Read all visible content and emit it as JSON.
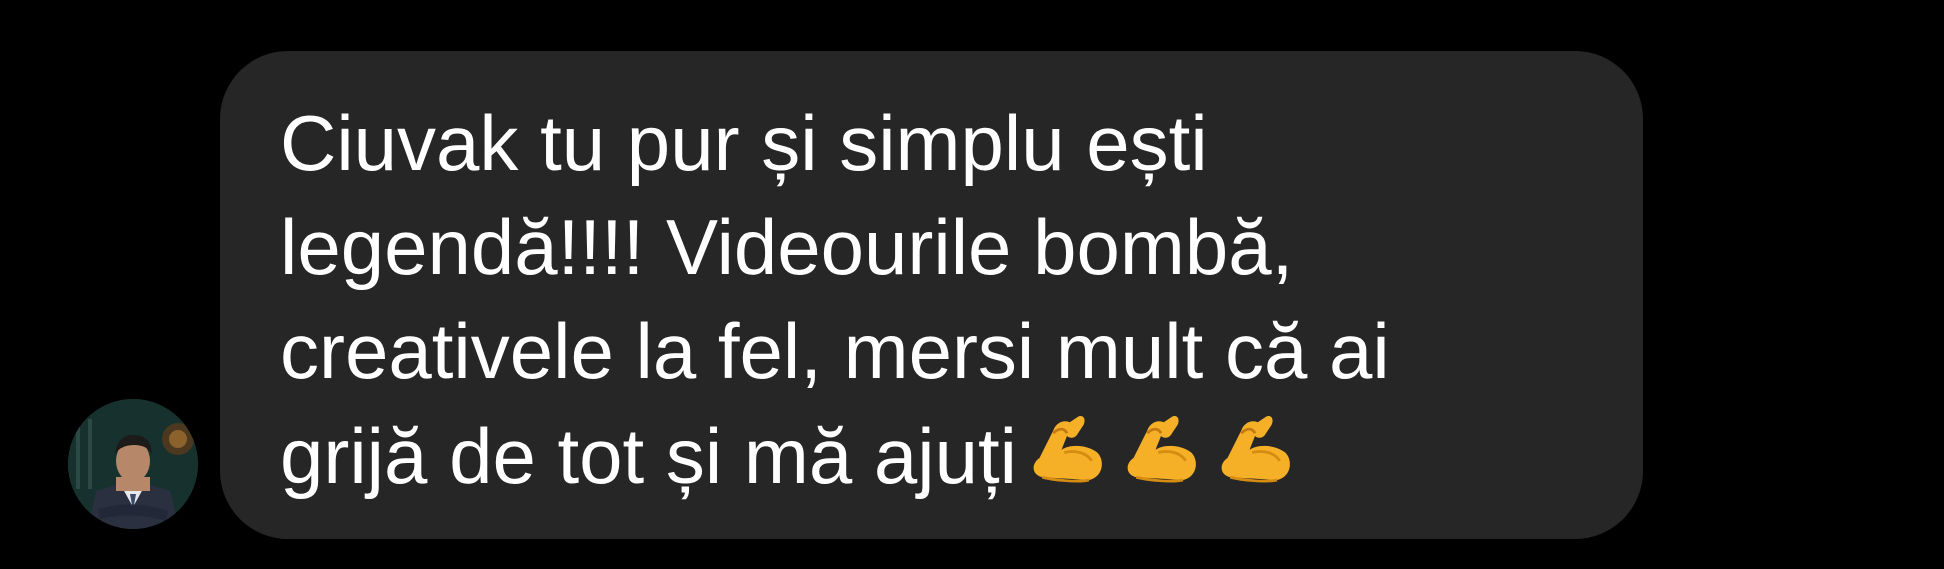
{
  "message": {
    "sender_avatar": "avatar-photo",
    "lines": [
      "Ciuvak tu pur și simplu ești",
      "legendă!!!! Videourile bombă,",
      "creativele la fel, mersi mult că ai",
      "grijă de tot și mă ajuți"
    ],
    "emoji": [
      "flexed-biceps-icon",
      "flexed-biceps-icon",
      "flexed-biceps-icon"
    ]
  },
  "colors": {
    "background": "#000000",
    "bubble": "#262626",
    "text": "#ffffff",
    "emoji": "#f7b52c"
  }
}
